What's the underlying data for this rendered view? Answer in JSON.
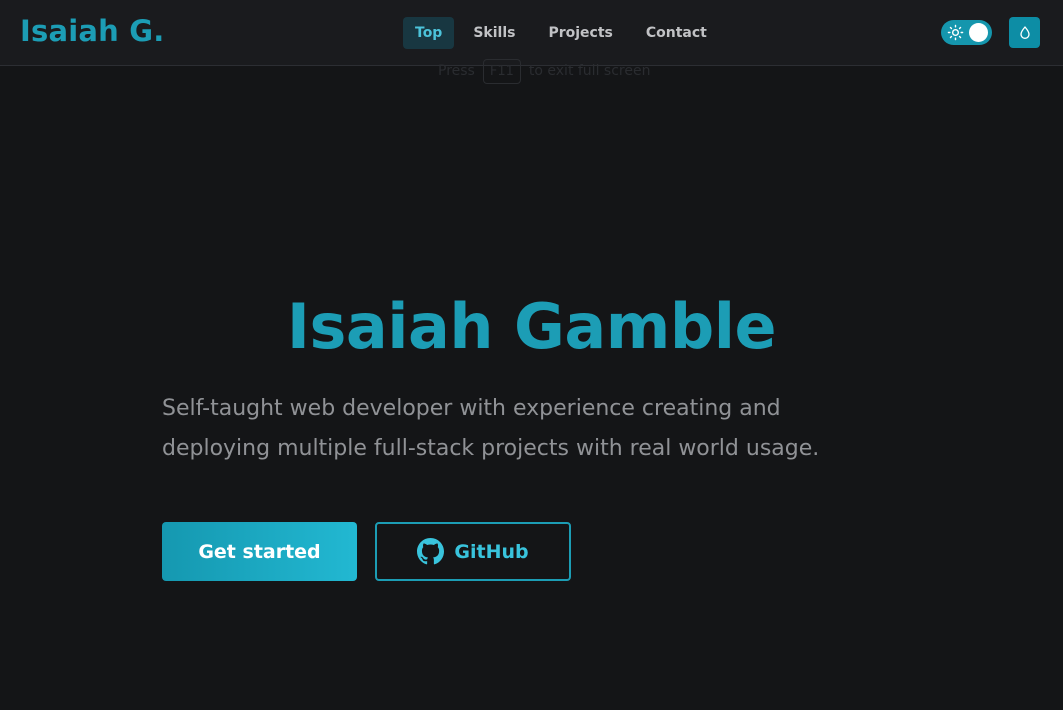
{
  "header": {
    "logo": "Isaiah G.",
    "nav": [
      {
        "label": "Top",
        "active": true
      },
      {
        "label": "Skills",
        "active": false
      },
      {
        "label": "Projects",
        "active": false
      },
      {
        "label": "Contact",
        "active": false
      }
    ],
    "theme_toggle": {
      "icon": "sun-icon",
      "state": "on"
    },
    "color_button_icon": "droplet-icon"
  },
  "fullscreen_hint": {
    "prefix": "Press",
    "key": "F11",
    "suffix": "to exit full screen"
  },
  "hero": {
    "title": "Isaiah Gamble",
    "subtitle": "Self-taught web developer with experience creating and deploying multiple full-stack projects with real world usage.",
    "primary_button": "Get started",
    "secondary_button": "GitHub",
    "secondary_icon": "github-icon"
  },
  "colors": {
    "accent": "#1c9db5",
    "background": "#141517",
    "header_bg": "#1a1b1e"
  }
}
